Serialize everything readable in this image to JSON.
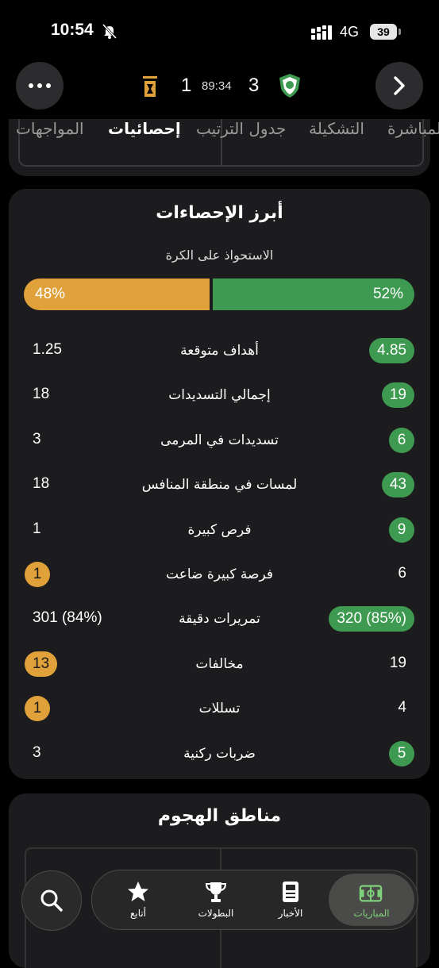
{
  "status_bar": {
    "time": "10:54",
    "network": "4G",
    "battery": "39"
  },
  "match": {
    "home_score": "3",
    "away_score": "1",
    "clock": "89:34"
  },
  "tabs": [
    "المباشرة",
    "التشكيلة",
    "جدول الترتيب",
    "إحصائيات",
    "المواجهات"
  ],
  "active_tab": "إحصائيات",
  "top_stats": {
    "title": "أبرز الإحصاءات",
    "possession": {
      "label": "الاستحواذ على الكرة",
      "home": "52%",
      "away": "48%",
      "home_fraction": 0.52
    },
    "rows": [
      {
        "label": "أهداف متوقعة",
        "home": "4.85",
        "away": "1.25",
        "highlight": "home"
      },
      {
        "label": "إجمالي التسديدات",
        "home": "19",
        "away": "18",
        "highlight": "home"
      },
      {
        "label": "تسديدات في المرمى",
        "home": "6",
        "away": "3",
        "highlight": "home"
      },
      {
        "label": "لمسات في منطقة المنافس",
        "home": "43",
        "away": "18",
        "highlight": "home"
      },
      {
        "label": "فرص كبيرة",
        "home": "9",
        "away": "1",
        "highlight": "home"
      },
      {
        "label": "فرصة كبيرة ضاعت",
        "home": "6",
        "away": "1",
        "highlight": "away"
      },
      {
        "label": "تمريرات دقيقة",
        "home": "320 (85%)",
        "away": "301 (84%)",
        "highlight": "home"
      },
      {
        "label": "مخالفات",
        "home": "19",
        "away": "13",
        "highlight": "away"
      },
      {
        "label": "تسللات",
        "home": "4",
        "away": "1",
        "highlight": "away"
      },
      {
        "label": "ضربات ركنية",
        "home": "5",
        "away": "3",
        "highlight": "home"
      }
    ]
  },
  "attack_zones": {
    "title": "مناطق الهجوم"
  },
  "bottom_nav": [
    {
      "label": "أتابع",
      "icon": "star-icon"
    },
    {
      "label": "البطولات",
      "icon": "trophy-icon"
    },
    {
      "label": "الأخبار",
      "icon": "news-icon"
    },
    {
      "label": "المباريات",
      "icon": "pitch-icon",
      "active": true
    }
  ],
  "colors": {
    "home": "#3e9a51",
    "away": "#e0a13a",
    "card": "#1c1c1e",
    "active_nav": "#7fd07b"
  }
}
